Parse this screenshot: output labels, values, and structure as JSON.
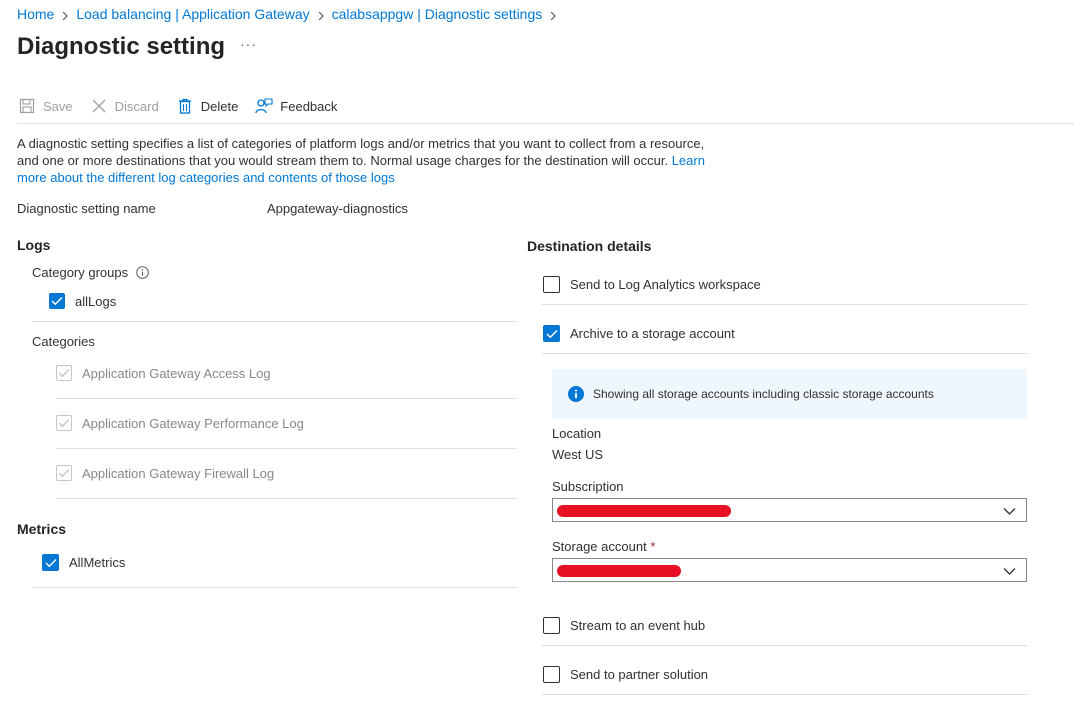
{
  "breadcrumb": {
    "items": [
      "Home",
      "Load balancing | Application Gateway",
      "calabsappgw | Diagnostic settings"
    ]
  },
  "page": {
    "title": "Diagnostic setting",
    "more": "···"
  },
  "toolbar": {
    "save": "Save",
    "discard": "Discard",
    "delete": "Delete",
    "feedback": "Feedback"
  },
  "description": {
    "text": "A diagnostic setting specifies a list of categories of platform logs and/or metrics that you want to collect from a resource, and one or more destinations that you would stream them to. Normal usage charges for the destination will occur. ",
    "link": "Learn more about the different log categories and contents of those logs"
  },
  "setting_name": {
    "label": "Diagnostic setting name",
    "value": "Appgateway-diagnostics"
  },
  "logs": {
    "heading": "Logs",
    "category_groups_label": "Category groups",
    "all_logs": {
      "label": "allLogs",
      "checked": true
    },
    "categories_label": "Categories",
    "categories": [
      {
        "label": "Application Gateway Access Log",
        "checked": true,
        "disabled": true
      },
      {
        "label": "Application Gateway Performance Log",
        "checked": true,
        "disabled": true
      },
      {
        "label": "Application Gateway Firewall Log",
        "checked": true,
        "disabled": true
      }
    ]
  },
  "metrics": {
    "heading": "Metrics",
    "all_metrics": {
      "label": "AllMetrics",
      "checked": true
    }
  },
  "destination": {
    "heading": "Destination details",
    "log_analytics": {
      "label": "Send to Log Analytics workspace",
      "checked": false
    },
    "storage": {
      "label": "Archive to a storage account",
      "checked": true
    },
    "info": "Showing all storage accounts including classic storage accounts",
    "location_label": "Location",
    "location_value": "West US",
    "subscription_label": "Subscription",
    "storage_account_label": "Storage account",
    "required_mark": "*",
    "event_hub": {
      "label": "Stream to an event hub",
      "checked": false
    },
    "partner": {
      "label": "Send to partner solution",
      "checked": false
    }
  },
  "colors": {
    "accent": "#0078d4",
    "redaction": "#e81123",
    "info_bg": "#eff6fc"
  }
}
